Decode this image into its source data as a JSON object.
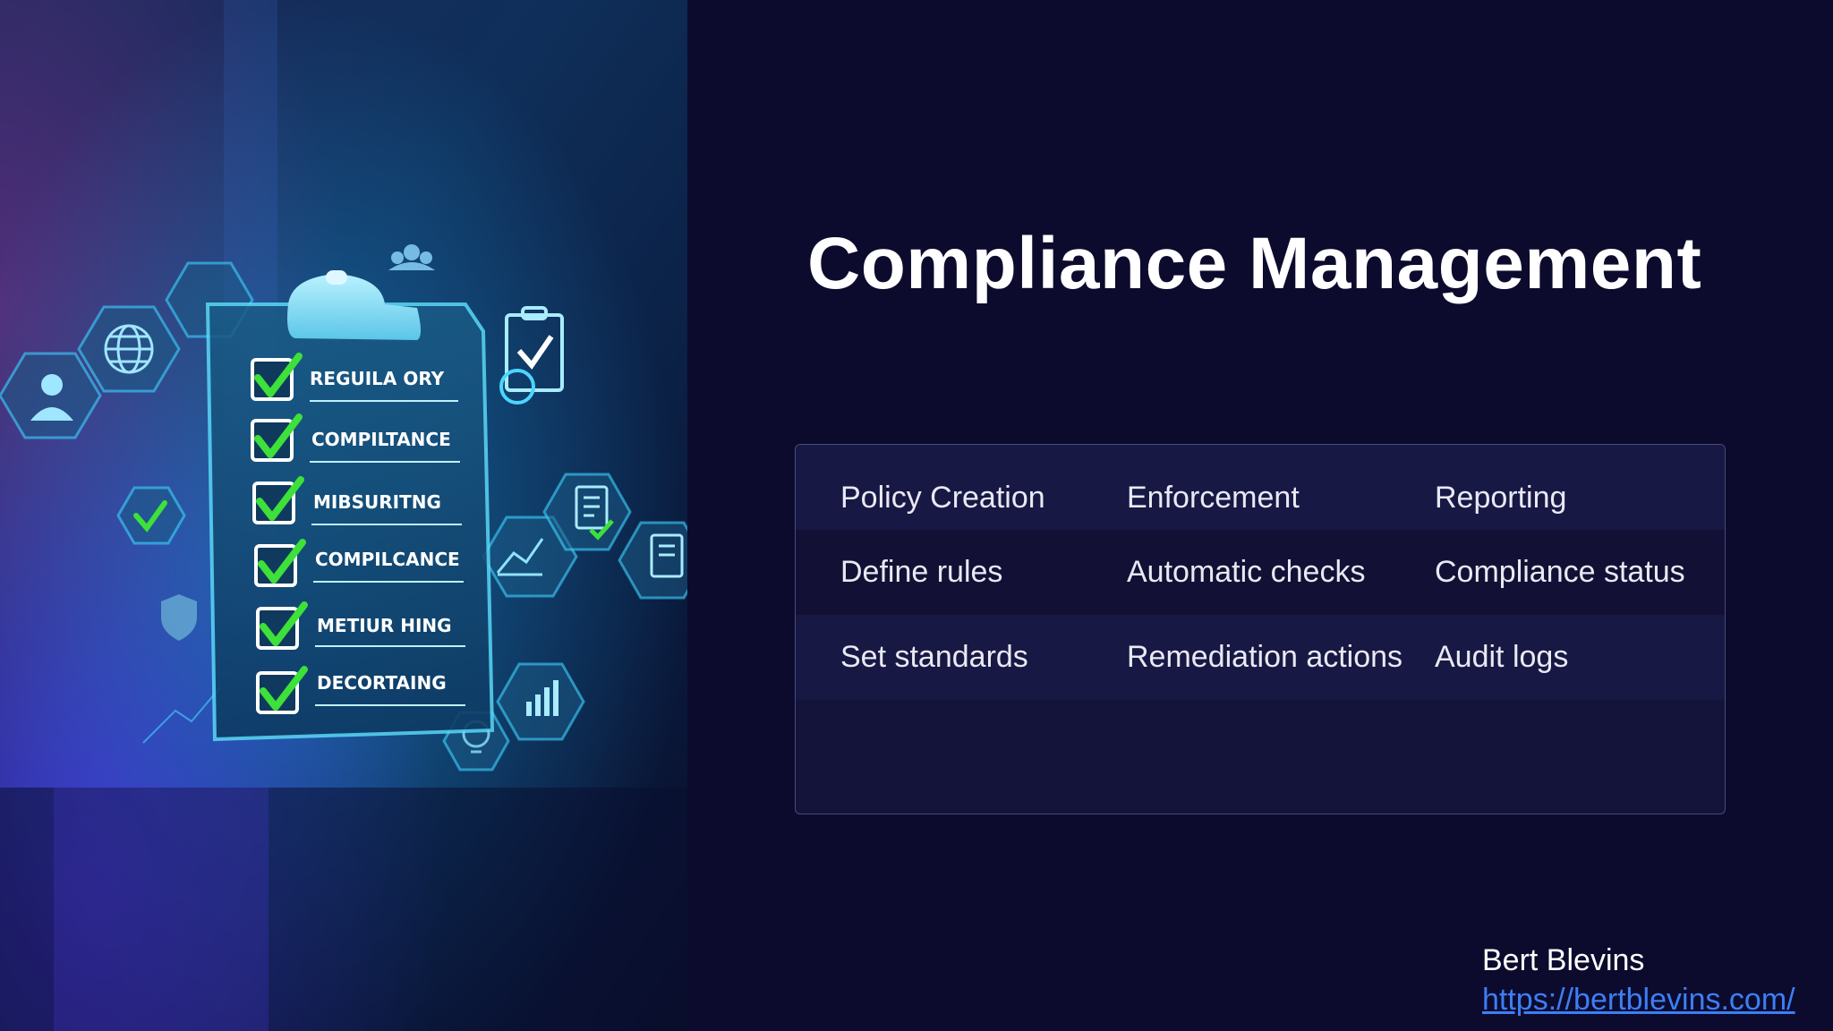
{
  "slide": {
    "title": "Compliance Management"
  },
  "table": {
    "headers": [
      "Policy Creation",
      "Enforcement",
      "Reporting"
    ],
    "rows": [
      [
        "Define rules",
        "Automatic checks",
        "Compliance status"
      ],
      [
        "Set standards",
        "Remediation actions",
        "Audit logs"
      ]
    ]
  },
  "illustration": {
    "checklist_items": [
      "REGUILA ORY",
      "COMPILTANCE",
      "MIBSURITNG",
      "COMPILCANCE",
      "METIUR HING",
      "DECORTAING"
    ],
    "icons": [
      "person-icon",
      "globe-icon",
      "checkmark-icon",
      "team-icon",
      "clipboard-check-icon",
      "document-check-icon",
      "chart-icon",
      "bar-chart-icon",
      "shield-icon",
      "lightbulb-icon"
    ]
  },
  "footer": {
    "name": "Bert Blevins",
    "url": "https://bertblevins.com/"
  },
  "colors": {
    "background": "#0c0b2e",
    "accent": "#3d7ef5",
    "check": "#3ee03a",
    "glow": "#2fd6ff"
  }
}
